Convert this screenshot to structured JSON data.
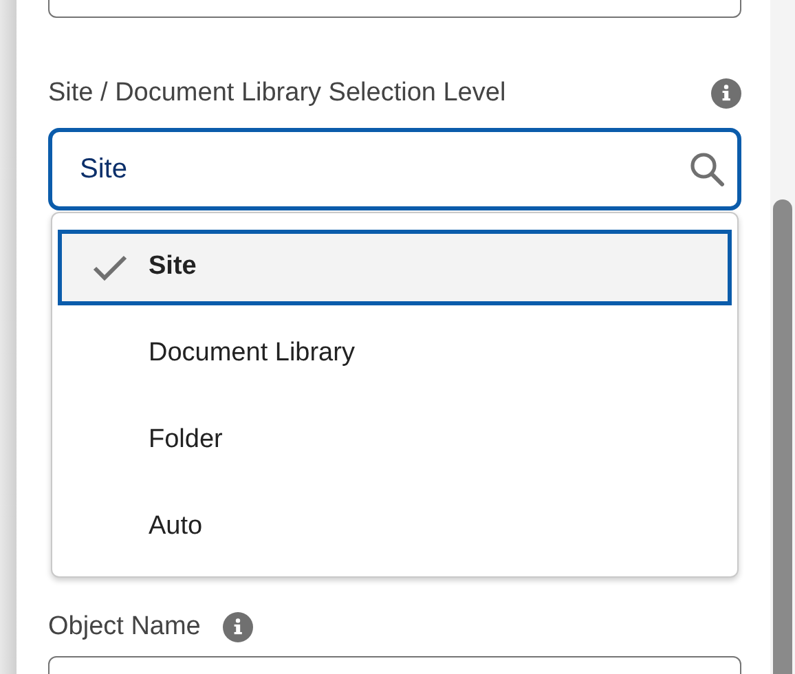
{
  "level_field": {
    "label": "Site / Document Library Selection Level",
    "value": "Site",
    "focused": true,
    "options": [
      {
        "label": "Site",
        "selected": true
      },
      {
        "label": "Document Library",
        "selected": false
      },
      {
        "label": "Folder",
        "selected": false
      },
      {
        "label": "Auto",
        "selected": false
      }
    ]
  },
  "object_field": {
    "label": "Object Name"
  }
}
